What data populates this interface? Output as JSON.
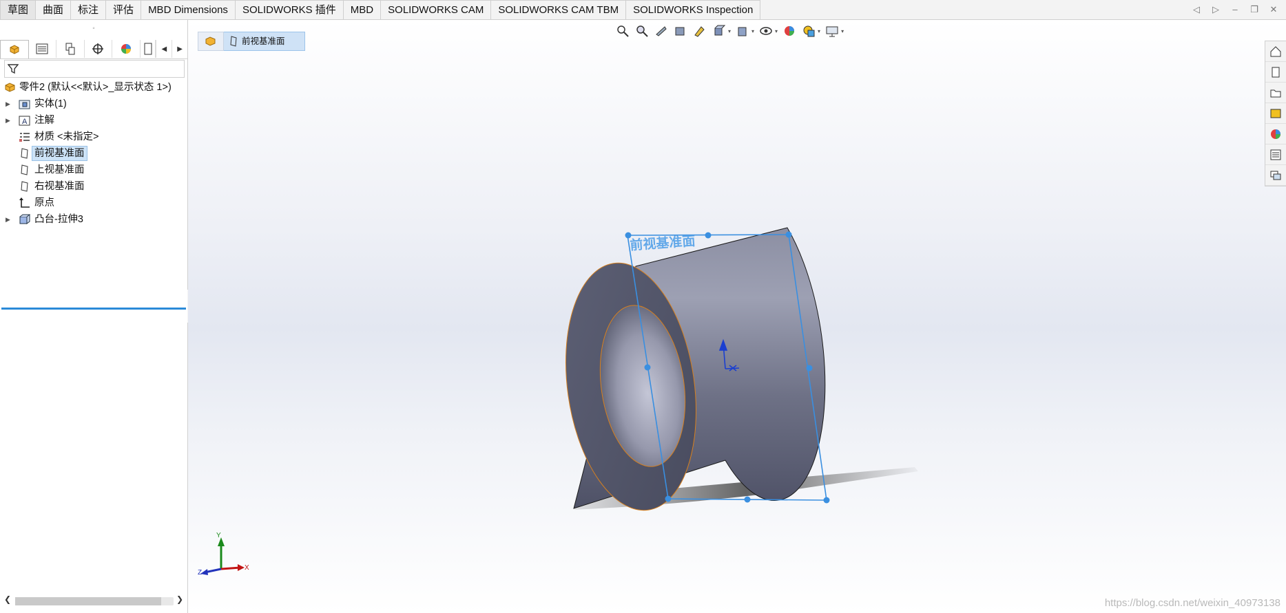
{
  "tabs": [
    "草图",
    "曲面",
    "标注",
    "评估",
    "MBD Dimensions",
    "SOLIDWORKS 插件",
    "MBD",
    "SOLIDWORKS CAM",
    "SOLIDWORKS CAM TBM",
    "SOLIDWORKS Inspection"
  ],
  "tree": {
    "root": "零件2 (默认<<默认>_显示状态 1>)",
    "items": [
      {
        "label": "实体(1)",
        "icon": "solid-bodies-folder-icon",
        "expandable": true
      },
      {
        "label": "注解",
        "icon": "annotations-icon",
        "expandable": true
      },
      {
        "label": "材质 <未指定>",
        "icon": "material-icon",
        "expandable": false
      },
      {
        "label": "前视基准面",
        "icon": "plane-icon",
        "expandable": false,
        "selected": true
      },
      {
        "label": "上视基准面",
        "icon": "plane-icon",
        "expandable": false
      },
      {
        "label": "右视基准面",
        "icon": "plane-icon",
        "expandable": false
      },
      {
        "label": "原点",
        "icon": "origin-icon",
        "expandable": false
      },
      {
        "label": "凸台-拉伸3",
        "icon": "boss-extrude-icon",
        "expandable": true
      }
    ]
  },
  "breadcrumb": {
    "item": "前视基准面"
  },
  "viewport": {
    "plane_label": "前视基准面",
    "triad": {
      "x": "X",
      "y": "Y",
      "z": "Z"
    },
    "watermark": "https://blog.csdn.net/weixin_40973138"
  },
  "colors": {
    "selection": "#2b8ad8",
    "edge_highlight": "#d8801e",
    "model": "#7a7d92",
    "tab_bg": "#f3f3f3"
  }
}
